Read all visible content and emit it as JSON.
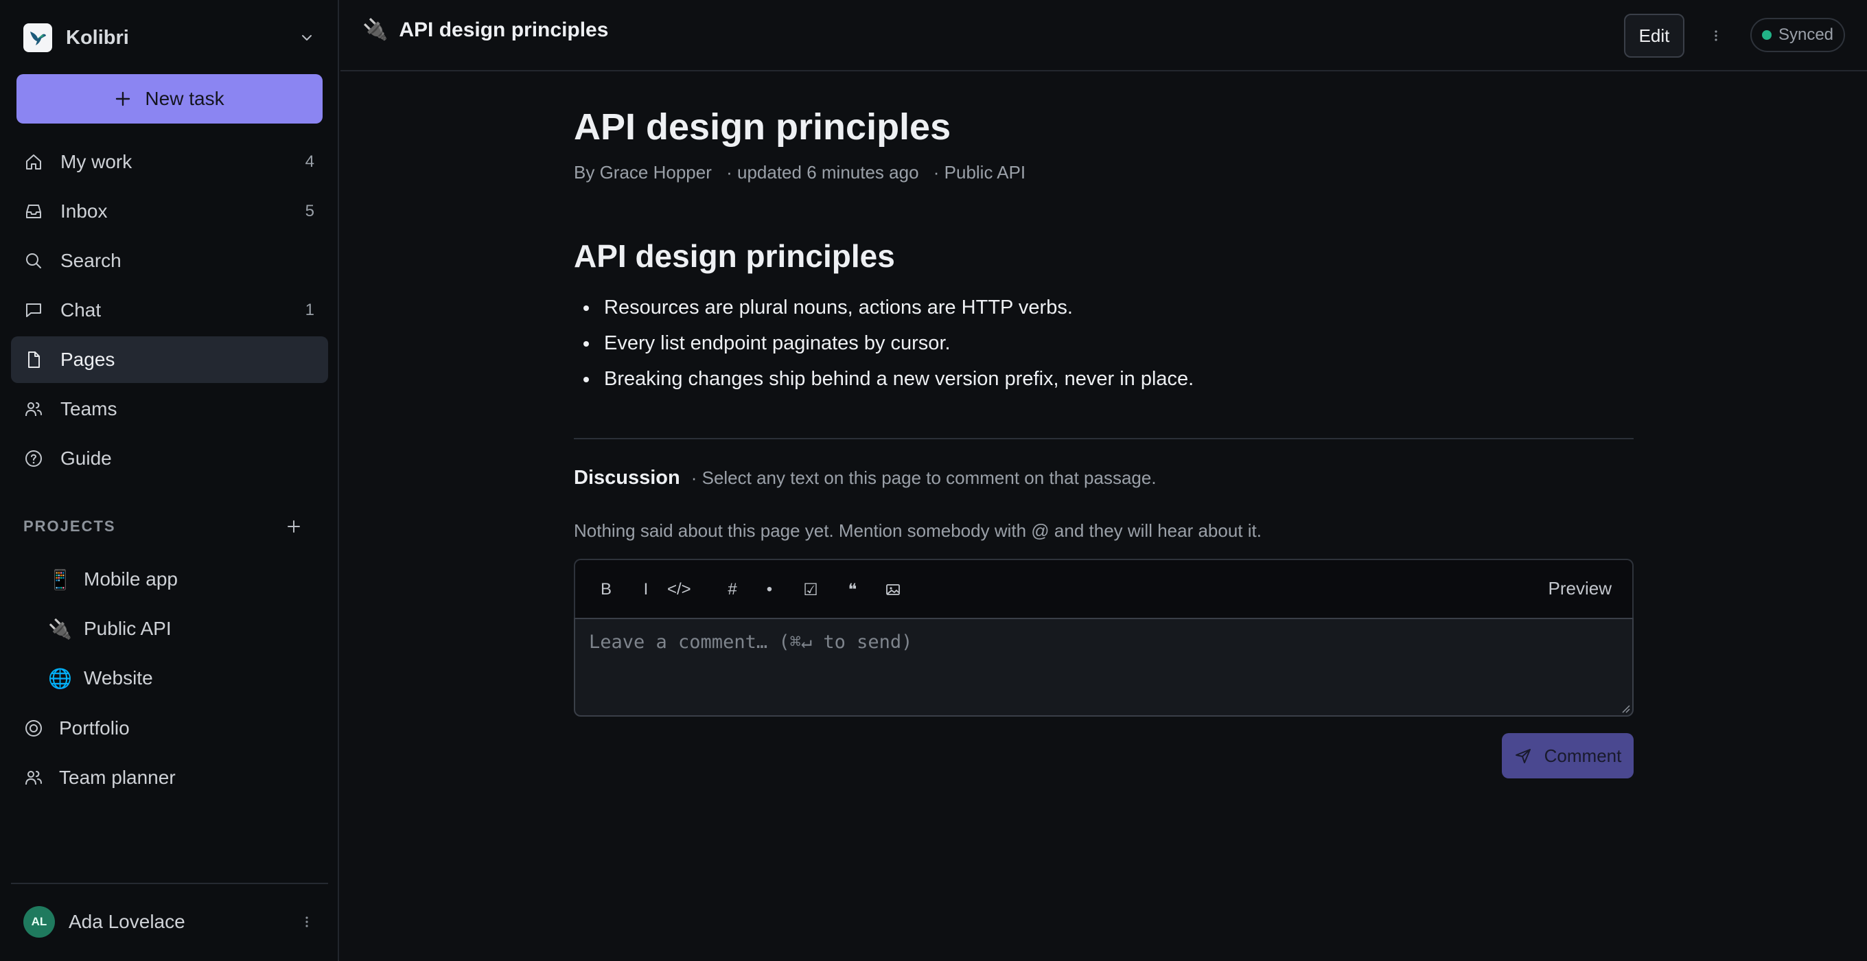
{
  "workspace": {
    "name": "Kolibri",
    "logo_icon": "hummingbird-icon"
  },
  "sidebar": {
    "new_task_label": "New task",
    "nav": [
      {
        "label": "My work",
        "count": "4",
        "icon": "home-icon"
      },
      {
        "label": "Inbox",
        "count": "5",
        "icon": "inbox-icon"
      },
      {
        "label": "Search",
        "count": "",
        "icon": "search-icon"
      },
      {
        "label": "Chat",
        "count": "1",
        "icon": "chat-icon"
      },
      {
        "label": "Pages",
        "count": "",
        "icon": "page-icon",
        "active": true
      },
      {
        "label": "Teams",
        "count": "",
        "icon": "users-icon"
      },
      {
        "label": "Guide",
        "count": "",
        "icon": "help-icon"
      }
    ],
    "projects_header": "PROJECTS",
    "projects": [
      {
        "emoji": "📱",
        "label": "Mobile app"
      },
      {
        "emoji": "🔌",
        "label": "Public API"
      },
      {
        "emoji": "🌐",
        "label": "Website"
      }
    ],
    "extra_nav": [
      {
        "label": "Portfolio",
        "icon": "target-icon"
      },
      {
        "label": "Team planner",
        "icon": "users-icon"
      }
    ],
    "user": {
      "initials": "AL",
      "name": "Ada Lovelace"
    }
  },
  "topbar": {
    "emoji": "🔌",
    "title": "API design principles",
    "edit_label": "Edit",
    "sync_status": "Synced"
  },
  "page": {
    "title": "API design principles",
    "meta": {
      "author": "By Grace Hopper",
      "updated": "· updated 6 minutes ago",
      "project": "· Public API"
    },
    "heading": "API design principles",
    "bullets": [
      "Resources are plural nouns, actions are HTTP verbs.",
      "Every list endpoint paginates by cursor.",
      "Breaking changes ship behind a new version prefix, never in place."
    ]
  },
  "discussion": {
    "title": "Discussion",
    "hint": "· Select any text on this page to comment on that passage.",
    "empty": "Nothing said about this page yet. Mention somebody with @ and they will hear about it.",
    "toolbar": [
      "B",
      "I",
      "</>",
      "#",
      "•",
      "☑",
      "❝"
    ],
    "preview_label": "Preview",
    "placeholder": "Leave a comment… (⌘↵ to send)",
    "submit_label": "Comment"
  },
  "colors": {
    "accent": "#8b85f2",
    "accent_muted": "#4a4890",
    "sync_dot": "#22b387",
    "avatar": "#1f7a5e"
  }
}
